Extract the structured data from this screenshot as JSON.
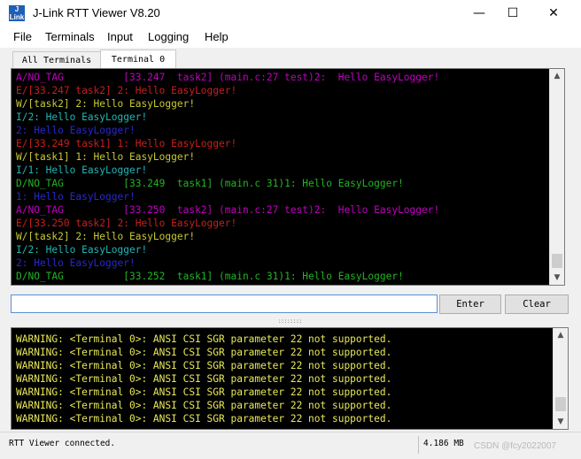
{
  "window": {
    "title": "J-Link RTT Viewer V8.20",
    "icon_text": "J Link",
    "minimize_glyph": "—",
    "maximize_glyph": "☐",
    "close_glyph": "✕"
  },
  "menu": [
    "File",
    "Terminals",
    "Input",
    "Logging",
    "Help"
  ],
  "tabs": [
    {
      "label": "All Terminals",
      "active": false
    },
    {
      "label": "Terminal 0",
      "active": true
    }
  ],
  "terminal": {
    "lines": [
      {
        "text": "A/NO_TAG          [33.247  task2] (main.c:27 test)2:  Hello EasyLogger!",
        "color": "#c000c0"
      },
      {
        "text": "E/[33.247 task2] 2: Hello EasyLogger!",
        "color": "#c81e1e"
      },
      {
        "text": "W/[task2] 2: Hello EasyLogger!",
        "color": "#c8c832"
      },
      {
        "text": "I/2: Hello EasyLogger!",
        "color": "#23b4b4"
      },
      {
        "text": "2: Hello EasyLogger!",
        "color": "#2828c8"
      },
      {
        "text": "E/[33.249 task1] 1: Hello EasyLogger!",
        "color": "#c81e1e"
      },
      {
        "text": "W/[task1] 1: Hello EasyLogger!",
        "color": "#c8c832"
      },
      {
        "text": "I/1: Hello EasyLogger!",
        "color": "#23b4b4"
      },
      {
        "text": "D/NO_TAG          [33.249  task1] (main.c 31)1: Hello EasyLogger!",
        "color": "#23b423"
      },
      {
        "text": "1: Hello EasyLogger!",
        "color": "#2828c8"
      },
      {
        "text": "A/NO_TAG          [33.250  task2] (main.c:27 test)2:  Hello EasyLogger!",
        "color": "#c000c0"
      },
      {
        "text": "E/[33.250 task2] 2: Hello EasyLogger!",
        "color": "#c81e1e"
      },
      {
        "text": "W/[task2] 2: Hello EasyLogger!",
        "color": "#c8c832"
      },
      {
        "text": "I/2: Hello EasyLogger!",
        "color": "#23b4b4"
      },
      {
        "text": "2: Hello EasyLogger!",
        "color": "#2828c8"
      },
      {
        "text": "D/NO_TAG          [33.252  task1] (main.c 31)1: Hello EasyLogger!",
        "color": "#23b423"
      }
    ]
  },
  "input": {
    "value": ""
  },
  "buttons": {
    "enter": "Enter",
    "clear": "Clear"
  },
  "splitter": "::::::::",
  "log": {
    "lines": [
      "WARNING: <Terminal 0>: ANSI CSI SGR parameter 22 not supported.",
      "WARNING: <Terminal 0>: ANSI CSI SGR parameter 22 not supported.",
      "WARNING: <Terminal 0>: ANSI CSI SGR parameter 22 not supported.",
      "WARNING: <Terminal 0>: ANSI CSI SGR parameter 22 not supported.",
      "WARNING: <Terminal 0>: ANSI CSI SGR parameter 22 not supported.",
      "WARNING: <Terminal 0>: ANSI CSI SGR parameter 22 not supported.",
      "WARNING: <Terminal 0>: ANSI CSI SGR parameter 22 not supported."
    ]
  },
  "status": {
    "text": "RTT Viewer connected.",
    "memory": "4.186 MB",
    "watermark": "CSDN @fcy2022007"
  },
  "scrollbars": {
    "up_glyph": "▲",
    "down_glyph": "▼"
  }
}
